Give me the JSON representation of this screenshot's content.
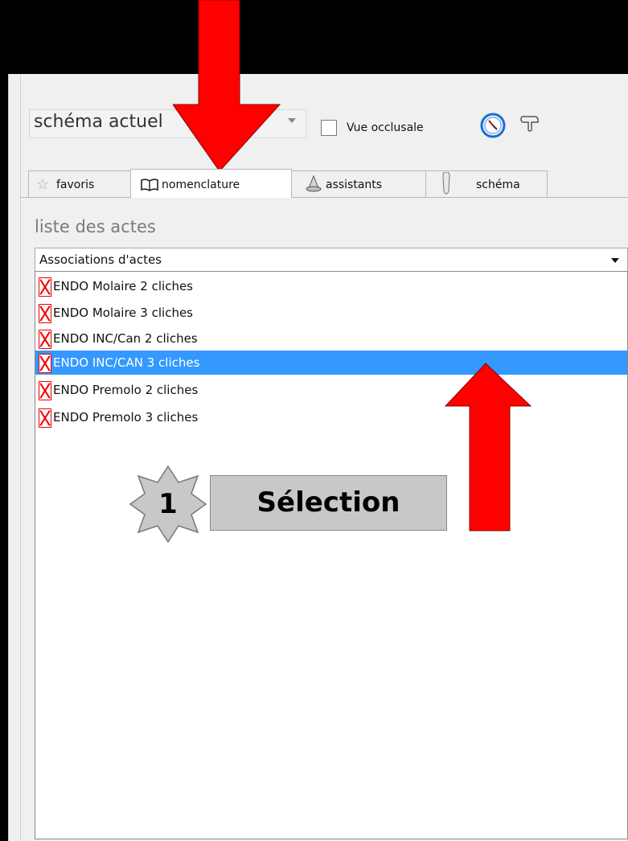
{
  "toolbar": {
    "view_combo": "schéma actuel",
    "occlusal_label": "Vue occlusale"
  },
  "tabs": [
    {
      "label": "favoris"
    },
    {
      "label": "nomenclature"
    },
    {
      "label": "assistants"
    },
    {
      "label": "schéma"
    }
  ],
  "section": {
    "title": "liste des actes",
    "select_value": "Associations d'actes"
  },
  "list": {
    "items": [
      {
        "label": "ENDO Molaire 2 cliches"
      },
      {
        "label": "ENDO Molaire 3 cliches"
      },
      {
        "label": "ENDO INC/Can 2 cliches"
      },
      {
        "label": "ENDO INC/CAN 3 cliches"
      },
      {
        "label": "ENDO Premolo 2 cliches"
      },
      {
        "label": "ENDO Premolo 3 cliches"
      }
    ],
    "selected_index": 3
  },
  "annotation": {
    "step": "1",
    "label": "Sélection"
  },
  "colors": {
    "selection": "#3399ff",
    "annotation_arrow": "#ff0000",
    "annotation_box": "#c8c8c8"
  }
}
